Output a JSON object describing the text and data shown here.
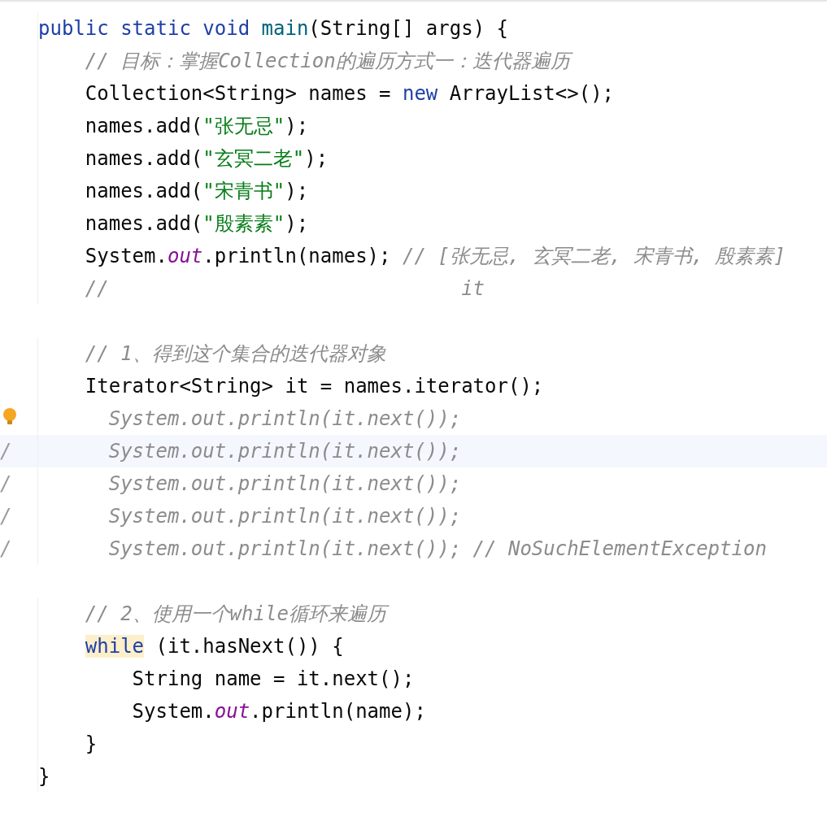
{
  "editor": {
    "lines": [
      {
        "tokens": [
          {
            "t": "public static void ",
            "kind": "keyword"
          },
          {
            "t": "main",
            "kind": "method"
          },
          {
            "t": "(String[] args) {",
            "kind": "plain"
          }
        ],
        "paragraphs": [
          {
            "lines": [
              {
                "tokens": [
                  {
                    "t": "// 目标：掌握Collection的遍历方式一：迭代器遍历",
                    "kind": "comment"
                  }
                ]
              },
              {
                "tokens": [
                  {
                    "t": "Collection<String> names = ",
                    "kind": "plain"
                  },
                  {
                    "t": "new ",
                    "kind": "keyword"
                  },
                  {
                    "t": "ArrayList<>();",
                    "kind": "plain"
                  }
                ]
              },
              {
                "tokens": [
                  {
                    "t": "names.add(",
                    "kind": "plain"
                  },
                  {
                    "t": "\"张无忌\"",
                    "kind": "string"
                  },
                  {
                    "t": ");",
                    "kind": "plain"
                  }
                ]
              },
              {
                "tokens": [
                  {
                    "t": "names.add(",
                    "kind": "plain"
                  },
                  {
                    "t": "\"玄冥二老\"",
                    "kind": "string"
                  },
                  {
                    "t": ");",
                    "kind": "plain"
                  }
                ]
              },
              {
                "tokens": [
                  {
                    "t": "names.add(",
                    "kind": "plain"
                  },
                  {
                    "t": "\"宋青书\"",
                    "kind": "string"
                  },
                  {
                    "t": ");",
                    "kind": "plain"
                  }
                ]
              },
              {
                "tokens": [
                  {
                    "t": "names.add(",
                    "kind": "plain"
                  },
                  {
                    "t": "\"殷素素\"",
                    "kind": "string"
                  },
                  {
                    "t": ");",
                    "kind": "plain"
                  }
                ]
              },
              {
                "tokens": [
                  {
                    "t": "System.",
                    "kind": "plain"
                  },
                  {
                    "t": "out",
                    "kind": "field"
                  },
                  {
                    "t": ".println(names); ",
                    "kind": "plain"
                  },
                  {
                    "t": "// [张无忌, 玄冥二老, 宋青书, 殷素素]",
                    "kind": "comment"
                  }
                ]
              },
              {
                "tokens": [
                  {
                    "t": "//                              it",
                    "kind": "comment"
                  }
                ]
              }
            ]
          },
          {
            "lines": [
              {
                "tokens": [
                  {
                    "t": "// 1、得到这个集合的迭代器对象",
                    "kind": "comment"
                  }
                ]
              },
              {
                "tokens": [
                  {
                    "t": "Iterator<String> it = names.iterator();",
                    "kind": "plain"
                  }
                ]
              },
              {
                "commented": true,
                "bulb": true,
                "tokens": [
                  {
                    "t": "System.out.println(it.next());",
                    "kind": "comment"
                  }
                ]
              },
              {
                "commented": true,
                "gutter": "/",
                "current": true,
                "tokens": [
                  {
                    "t": "System.out.println(it.next());",
                    "kind": "comment"
                  }
                ]
              },
              {
                "commented": true,
                "gutter": "/",
                "tokens": [
                  {
                    "t": "System.out.println(it.next());",
                    "kind": "comment"
                  }
                ]
              },
              {
                "commented": true,
                "gutter": "/",
                "tokens": [
                  {
                    "t": "System.out.println(it.next());",
                    "kind": "comment"
                  }
                ]
              },
              {
                "commented": true,
                "gutter": "/",
                "tokens": [
                  {
                    "t": "System.out.println(it.next()); // NoSuchElementException",
                    "kind": "comment"
                  }
                ]
              }
            ]
          },
          {
            "lines": [
              {
                "tokens": [
                  {
                    "t": "// 2、使用一个while循环来遍历",
                    "kind": "comment"
                  }
                ]
              },
              {
                "tokens": [
                  {
                    "t": "while",
                    "kind": "keyword_marked"
                  },
                  {
                    "t": " (it.hasNext()) {",
                    "kind": "plain"
                  }
                ],
                "children": [
                  {
                    "tokens": [
                      {
                        "t": "String name = it.next();",
                        "kind": "plain"
                      }
                    ]
                  },
                  {
                    "tokens": [
                      {
                        "t": "System.",
                        "kind": "plain"
                      },
                      {
                        "t": "out",
                        "kind": "field"
                      },
                      {
                        "t": ".println(name);",
                        "kind": "plain"
                      }
                    ]
                  }
                ]
              },
              {
                "tokens": [
                  {
                    "t": "}",
                    "kind": "plain"
                  }
                ]
              }
            ]
          }
        ]
      },
      {
        "tokens": [
          {
            "t": "}",
            "kind": "plain"
          }
        ]
      }
    ]
  }
}
